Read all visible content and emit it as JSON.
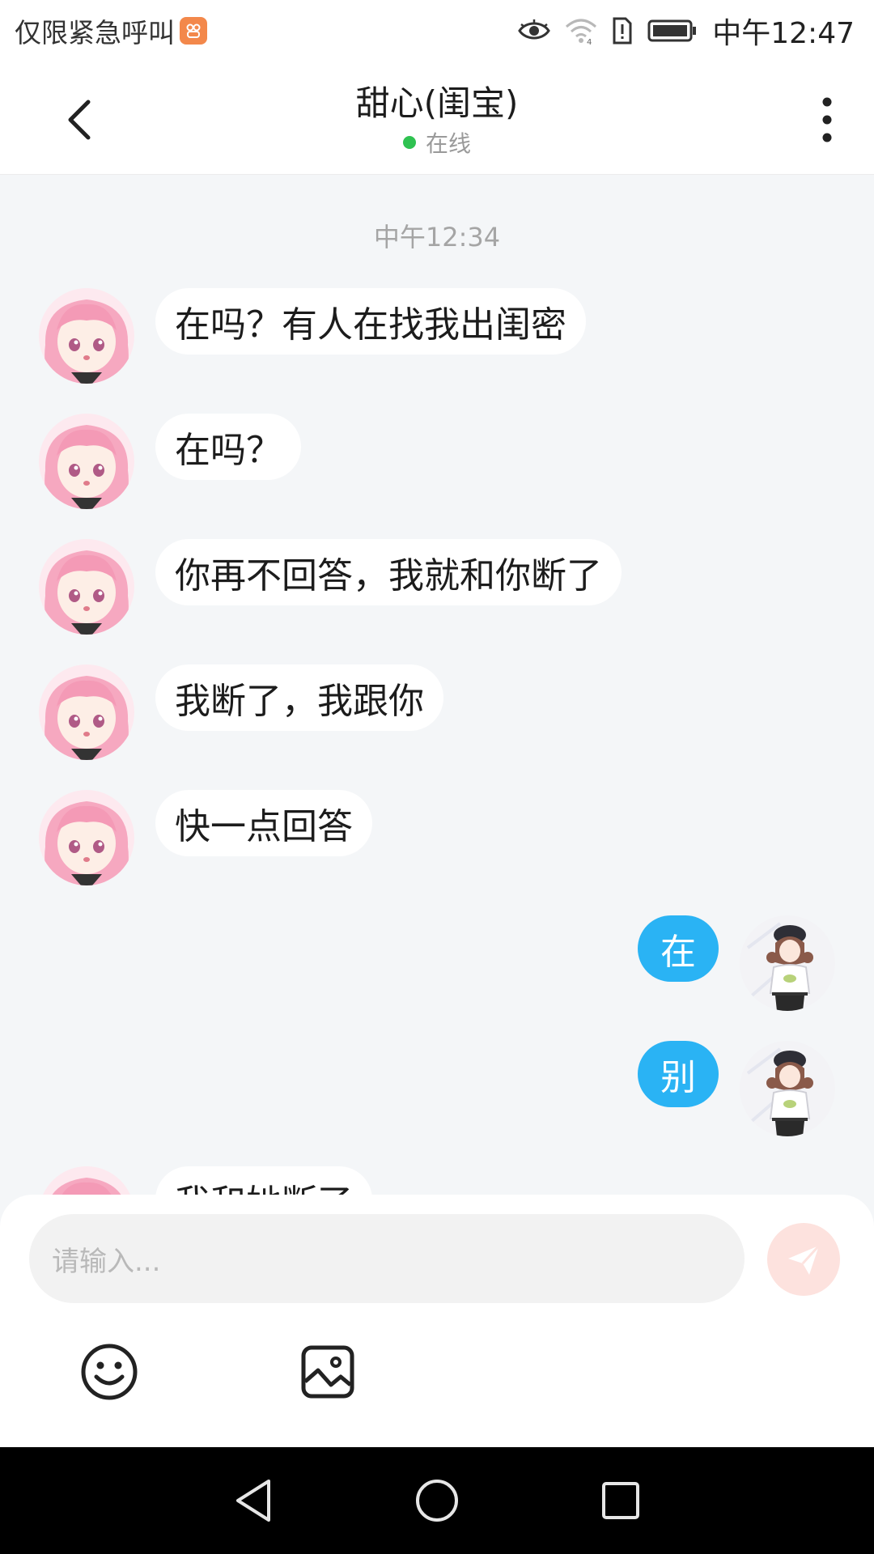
{
  "status_bar": {
    "left_text": "仅限紧急呼叫",
    "time": "中午12:47",
    "icons": [
      "app-badge-icon",
      "eye-icon",
      "wifi-icon",
      "sim-alert-icon",
      "battery-icon"
    ]
  },
  "header": {
    "title": "甜心(闺宝)",
    "status": "在线",
    "back_icon": "chevron-left-icon",
    "more_icon": "more-vertical-icon"
  },
  "chat": {
    "time_separator": "中午12:34",
    "messages": [
      {
        "side": "in",
        "text": "在吗？有人在找我出闺密"
      },
      {
        "side": "in",
        "text": "在吗？"
      },
      {
        "side": "in",
        "text": "你再不回答，我就和你断了"
      },
      {
        "side": "in",
        "text": "我断了，我跟你"
      },
      {
        "side": "in",
        "text": "快一点回答"
      },
      {
        "side": "out",
        "text": "在"
      },
      {
        "side": "out",
        "text": "别"
      },
      {
        "side": "in",
        "text": "我和她断了"
      }
    ]
  },
  "input": {
    "placeholder": "请输入...",
    "send_icon": "send-icon",
    "emoji_icon": "emoji-icon",
    "image_icon": "image-icon"
  },
  "nav_bar": {
    "icons": [
      "back-triangle-icon",
      "home-circle-icon",
      "recents-square-icon"
    ]
  },
  "colors": {
    "accent": "#2ab3f4",
    "online": "#2fc251",
    "send_button": "#fde2de",
    "background": "#f4f6f8"
  }
}
